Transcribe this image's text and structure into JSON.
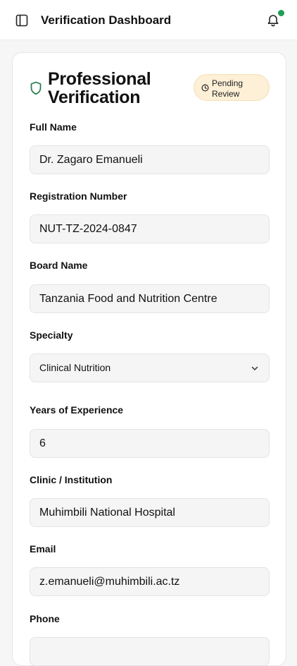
{
  "header": {
    "title": "Verification Dashboard",
    "sidebar_toggle_icon": "sidebar-toggle-icon",
    "notification_icon": "bell-icon",
    "notification_dot_color": "#1f9d57"
  },
  "card": {
    "title": "Professional Verification",
    "title_icon": "shield-icon",
    "status_badge": {
      "label": "Pending Review",
      "icon": "clock-icon",
      "background": "#fdf0d6"
    },
    "fields": [
      {
        "label": "Full Name",
        "value": "Dr. Zagaro Emanueli"
      },
      {
        "label": "Registration Number",
        "value": "NUT-TZ-2024-0847"
      },
      {
        "label": "Board Name",
        "value": "Tanzania Food and Nutrition Centre"
      },
      {
        "label": "Specialty",
        "value": "Clinical Nutrition",
        "type": "select"
      },
      {
        "label": "Years of Experience",
        "value": "6"
      },
      {
        "label": "Clinic / Institution",
        "value": "Muhimbili National Hospital"
      },
      {
        "label": "Email",
        "value": "z.emanueli@muhimbili.ac.tz"
      },
      {
        "label": "Phone",
        "value": ""
      }
    ]
  }
}
